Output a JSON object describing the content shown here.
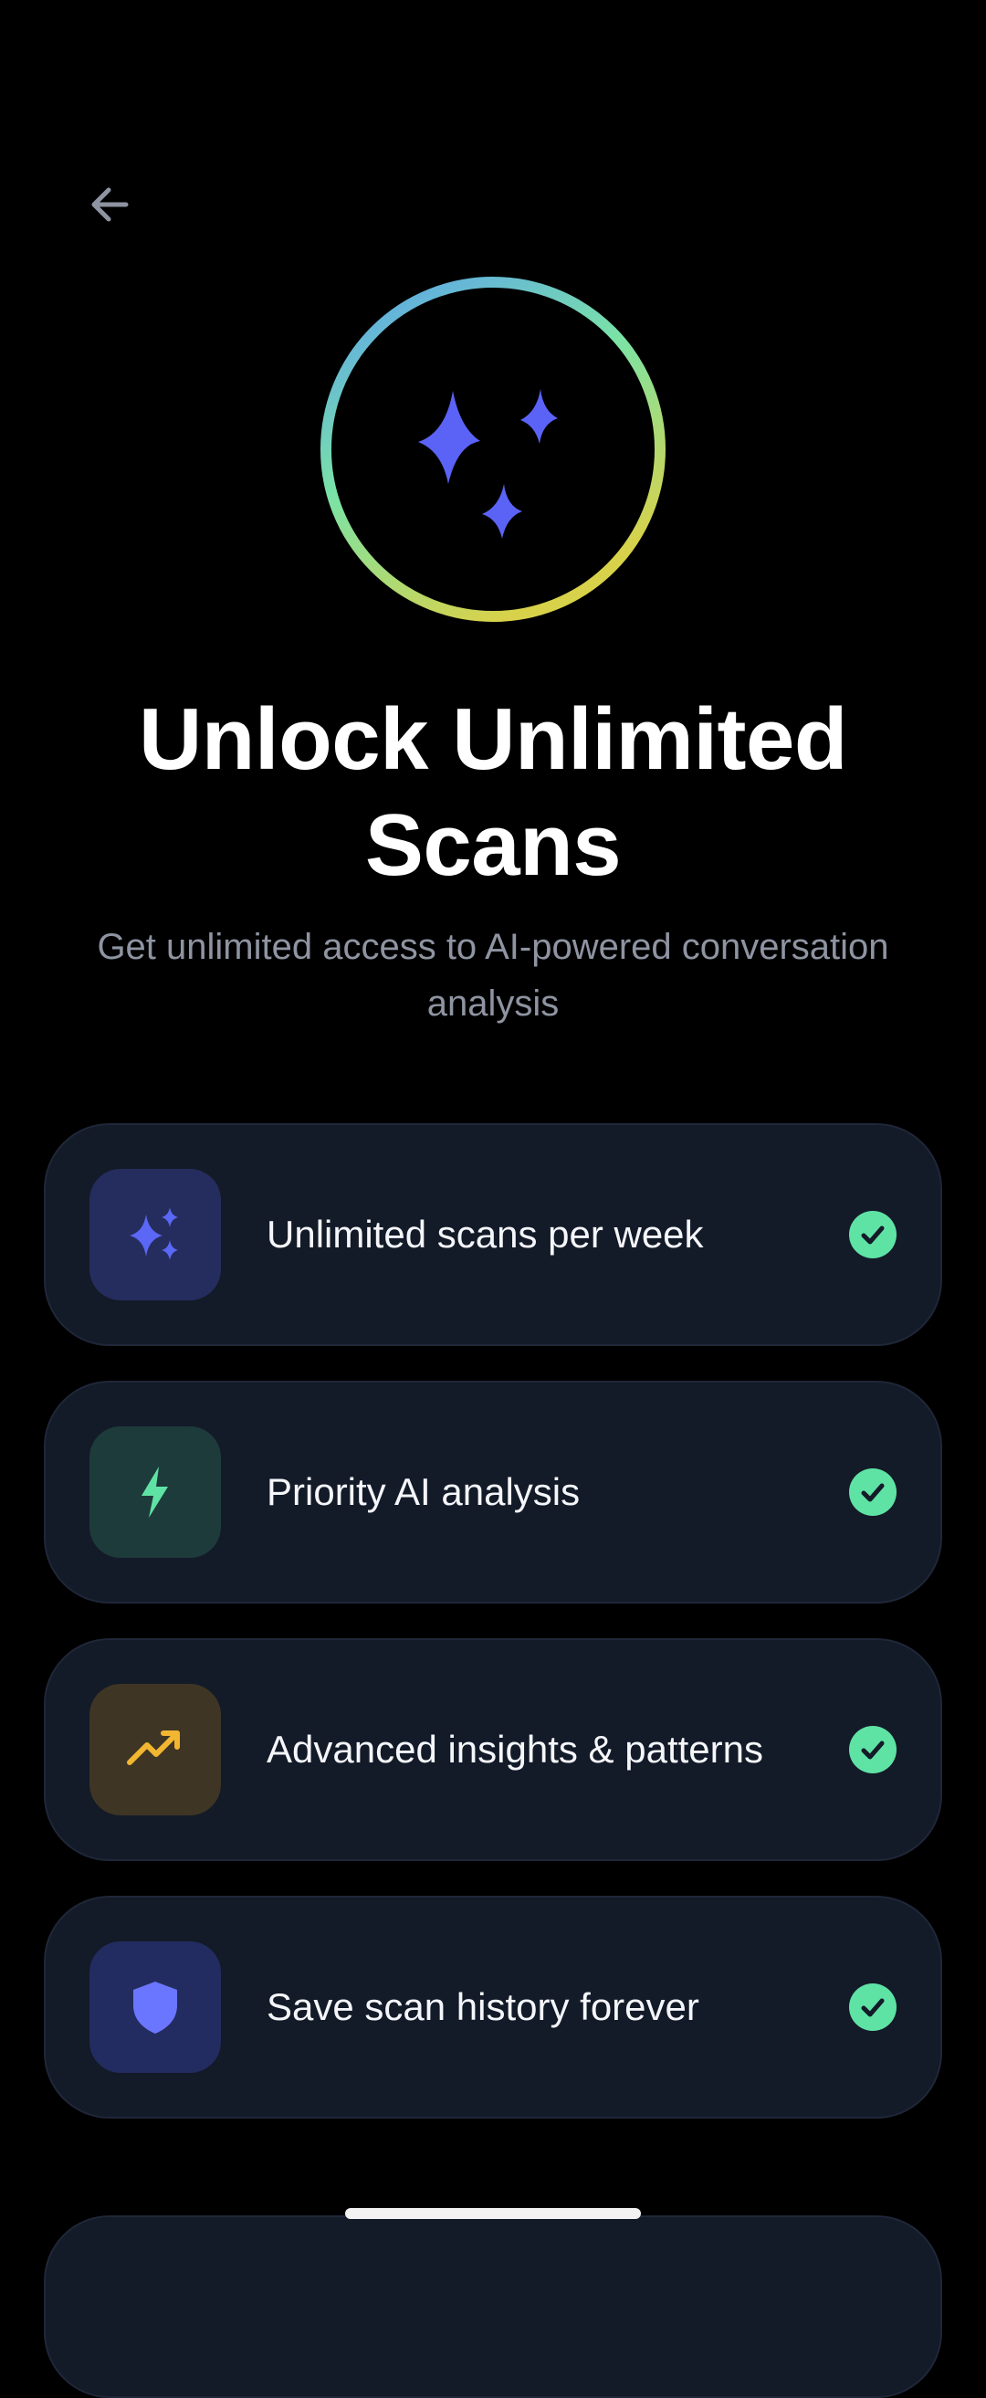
{
  "header": {
    "back_icon": "arrow-left-icon"
  },
  "hero": {
    "icon": "sparkles-icon",
    "ring_colors": [
      "#5aa0f0",
      "#7be3a6",
      "#d8d24a"
    ],
    "sparkle_color": "#5b63f7"
  },
  "title": "Unlock Unlimited Scans",
  "subtitle": "Get unlimited access to AI-powered conversation analysis",
  "features": [
    {
      "label": "Unlimited scans per week",
      "icon": "sparkles-icon",
      "icon_color": "#5b68f5",
      "tile_color": "#252d5e",
      "checked": true
    },
    {
      "label": "Priority AI analysis",
      "icon": "lightning-bolt-icon",
      "icon_color": "#5fe3a5",
      "tile_color": "#1e3b3b",
      "checked": true
    },
    {
      "label": "Advanced insights & patterns",
      "icon": "trending-up-icon",
      "icon_color": "#f2b631",
      "tile_color": "#3e3524",
      "checked": true
    },
    {
      "label": "Save scan history forever",
      "icon": "shield-icon",
      "icon_color": "#6a76ff",
      "tile_color": "#232c60",
      "checked": true
    }
  ],
  "check_icon": "check-circle-icon",
  "check_color": "#5fe3a5",
  "background_color": "#000000",
  "card_color": "#131a28"
}
